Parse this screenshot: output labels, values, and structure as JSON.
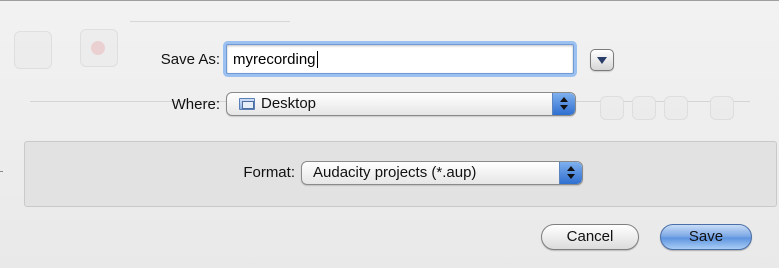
{
  "save_as": {
    "label": "Save As:",
    "value": "myrecording"
  },
  "where": {
    "label": "Where:",
    "selected": "Desktop",
    "icon": "folder-icon"
  },
  "format": {
    "label": "Format:",
    "selected": "Audacity projects (*.aup)"
  },
  "buttons": {
    "expand_icon": "disclosure-triangle-icon",
    "cancel": "Cancel",
    "save": "Save"
  },
  "colors": {
    "focus_ring": "#9cc0ef",
    "default_button": "#5f95e0",
    "popup_arrows": "#2f6fd0"
  }
}
